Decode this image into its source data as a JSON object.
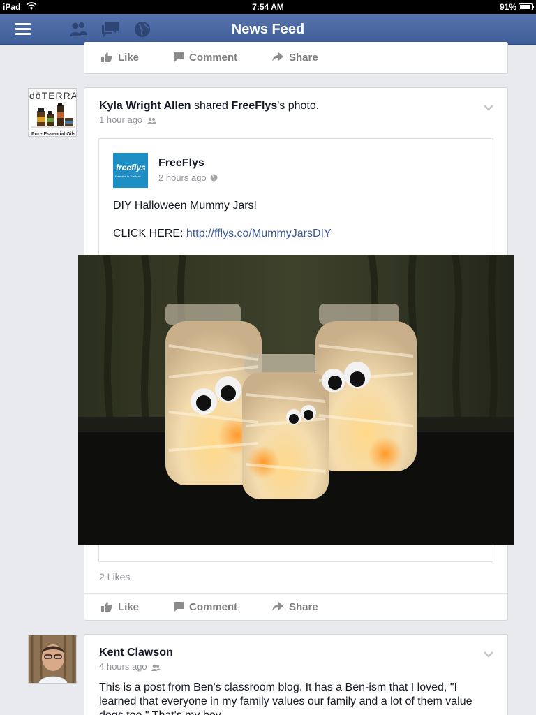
{
  "status_bar": {
    "device": "iPad",
    "time": "7:54 AM",
    "battery": "91%"
  },
  "nav": {
    "title": "News Feed"
  },
  "actions": {
    "like": "Like",
    "comment": "Comment",
    "share": "Share"
  },
  "post1": {
    "author": "Kyla Wright Allen",
    "verb": "shared",
    "page": "FreeFlys",
    "object": "'s photo.",
    "time": "1 hour ago",
    "avatar_text": "dōTERRA",
    "avatar_caption": "Pure Essential Oils",
    "shared": {
      "page_name": "FreeFlys",
      "logo_text": "freeflys",
      "logo_sub": "Freebies In The Mail",
      "time": "2 hours ago",
      "text": "DIY Halloween Mummy Jars!",
      "click_label": "CLICK HERE:",
      "link": "http://fflys.co/MummyJarsDIY"
    },
    "likes": "2 Likes"
  },
  "post2": {
    "author": "Kent Clawson",
    "time": "4 hours ago",
    "text": "This is a post from Ben's classroom blog. It has a Ben-ism that I loved, \"I learned that everyone in my family values our family and a lot of them value dogs too.\" That's my boy."
  },
  "colors": {
    "nav": "#4a66a0",
    "link": "#3b5998",
    "background": "#e9eaed"
  }
}
